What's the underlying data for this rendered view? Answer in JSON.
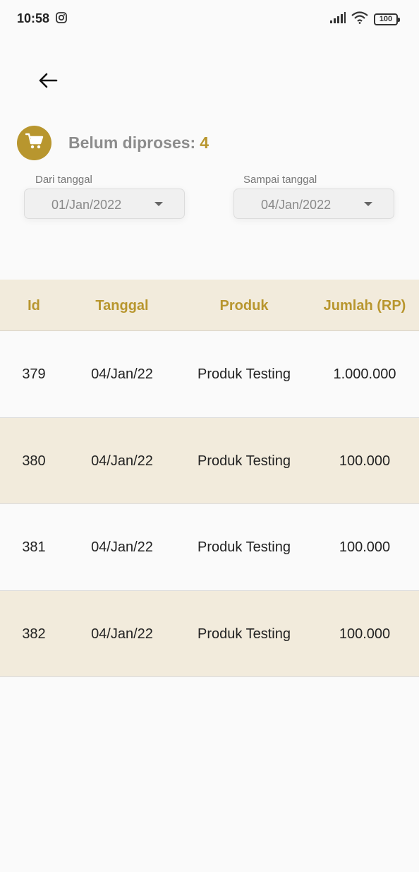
{
  "status_bar": {
    "time": "10:58",
    "battery": "100"
  },
  "summary": {
    "label": "Belum diproses:",
    "count": "4"
  },
  "filters": {
    "from": {
      "caption": "Dari tanggal",
      "value": "01/Jan/2022"
    },
    "to": {
      "caption": "Sampai tanggal",
      "value": "04/Jan/2022"
    }
  },
  "table": {
    "headers": {
      "id": "Id",
      "tanggal": "Tanggal",
      "produk": "Produk",
      "jumlah": "Jumlah (RP)"
    },
    "rows": [
      {
        "id": "379",
        "tanggal": "04/Jan/22",
        "produk": "Produk Testing",
        "jumlah": "1.000.000"
      },
      {
        "id": "380",
        "tanggal": "04/Jan/22",
        "produk": "Produk Testing",
        "jumlah": "100.000"
      },
      {
        "id": "381",
        "tanggal": "04/Jan/22",
        "produk": "Produk Testing",
        "jumlah": "100.000"
      },
      {
        "id": "382",
        "tanggal": "04/Jan/22",
        "produk": "Produk Testing",
        "jumlah": "100.000"
      }
    ]
  },
  "colors": {
    "accent": "#b8962e",
    "row_alt": "#f2ebdc",
    "background": "#fafafa"
  },
  "icons": {
    "back": "arrow-left-icon",
    "cart": "cart-icon",
    "dropdown": "caret-down-icon",
    "instagram": "instagram-icon",
    "signal": "signal-icon",
    "wifi": "wifi-icon",
    "battery": "battery-icon"
  }
}
